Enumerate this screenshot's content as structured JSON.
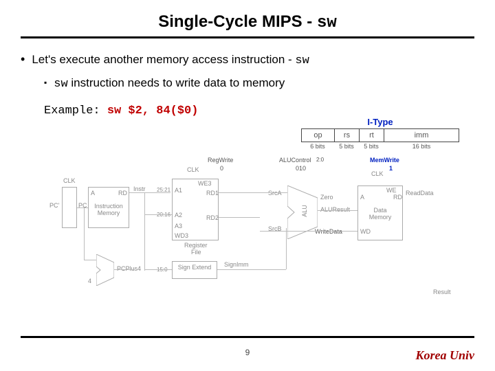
{
  "title": {
    "pre": "Single-Cycle MIPS - ",
    "code": "sw"
  },
  "bullet1": {
    "pre": "Let's execute another memory access instruction - ",
    "code": "sw"
  },
  "bullet2": {
    "code": "sw",
    "post": " instruction needs to write data to memory"
  },
  "example": {
    "label": "Example: ",
    "code": "sw $2, 84($0)"
  },
  "itype": {
    "title": "I-Type",
    "fields": {
      "op": "op",
      "rs": "rs",
      "rt": "rt",
      "imm": "imm"
    },
    "bits": {
      "op": "6 bits",
      "rs": "5 bits",
      "rt": "5 bits",
      "imm": "16 bits"
    }
  },
  "diagram": {
    "clk": "CLK",
    "pc_prime": "PC'",
    "pc": "PC",
    "a": "A",
    "rd": "RD",
    "instr": "Instr",
    "instr_mem": "Instruction",
    "memory": "Memory",
    "bits_25_21": "25:21",
    "bits_20_16": "20:16",
    "bits_15_0": "15:0",
    "a1": "A1",
    "a2": "A2",
    "a3": "A3",
    "we3": "WE3",
    "wd3": "WD3",
    "rd1": "RD1",
    "rd2": "RD2",
    "regfile": "Register",
    "file": "File",
    "regwrite": "RegWrite",
    "regwrite_val": "0",
    "srca": "SrcA",
    "srcb": "SrcB",
    "alucontrol": "ALUControl",
    "alucontrol_bits": "2:0",
    "alucontrol_val": "010",
    "zero": "Zero",
    "aluresult": "ALUResult",
    "alu": "ALU",
    "writedata": "WriteData",
    "memwrite": "MemWrite",
    "memwrite_val": "1",
    "we": "WE",
    "wd": "WD",
    "datamem": "Data",
    "readdata": "ReadData",
    "signext": "Sign Extend",
    "signimm": "SignImm",
    "pcplus4": "PCPlus4",
    "four": "4",
    "result": "Result"
  },
  "page": "9",
  "footer": "Korea Univ"
}
